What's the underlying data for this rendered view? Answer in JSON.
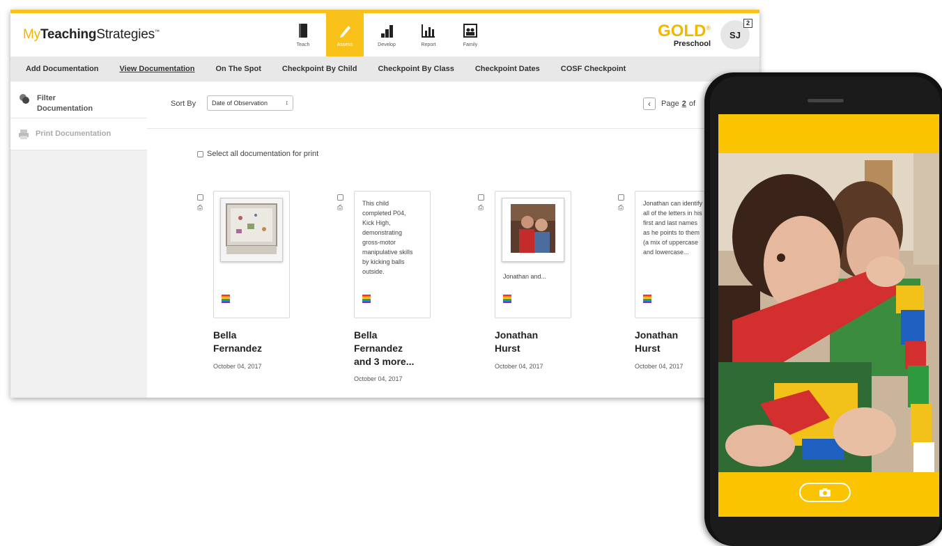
{
  "logo": {
    "my": "My",
    "teaching": "Teaching",
    "strategies": "Strategies",
    "tm": "™"
  },
  "nav": [
    {
      "label": "Teach",
      "icon": "book-icon"
    },
    {
      "label": "Assess",
      "icon": "pencil-icon",
      "active": true
    },
    {
      "label": "Develop",
      "icon": "steps-icon"
    },
    {
      "label": "Report",
      "icon": "bar-chart-icon"
    },
    {
      "label": "Family",
      "icon": "family-icon"
    }
  ],
  "brand": {
    "gold": "GOLD",
    "reg": "®",
    "level": "Preschool"
  },
  "user": {
    "initials": "SJ",
    "notifications": "2"
  },
  "subnav": [
    "Add Documentation",
    "View Documentation",
    "On The Spot",
    "Checkpoint By Child",
    "Checkpoint By Class",
    "Checkpoint Dates",
    "COSF Checkpoint"
  ],
  "sidebar": {
    "filter": "Filter Documentation",
    "print": "Print Documentation"
  },
  "sort": {
    "label": "Sort By",
    "value": "Date of Observation"
  },
  "pager": {
    "page_word": "Page",
    "current": "2",
    "of_word": "of"
  },
  "select_all": "Select all documentation for print",
  "cards": [
    {
      "type": "image",
      "caption": "",
      "name_line1": "Bella",
      "name_line2": "Fernandez",
      "date": "October 04, 2017"
    },
    {
      "type": "note",
      "note": "This child completed P04, Kick High, demonstrating gross-motor manipulative skills by kicking balls outside.",
      "name_line1": "Bella",
      "name_line2": "Fernandez",
      "name_line3": "and 3 more...",
      "date": "October 04, 2017"
    },
    {
      "type": "image",
      "caption": "Jonathan and...",
      "name_line1": "Jonathan",
      "name_line2": "Hurst",
      "date": "October 04, 2017"
    },
    {
      "type": "note",
      "note": "Jonathan can identify all of the letters in his first and last names as he points to them (a mix of uppercase and lowercase...",
      "name_line1": "Jonathan",
      "name_line2": "Hurst",
      "date": "October 04, 2017"
    }
  ],
  "colors": {
    "accent": "#f8c21b",
    "gold_text": "#f2b700"
  }
}
